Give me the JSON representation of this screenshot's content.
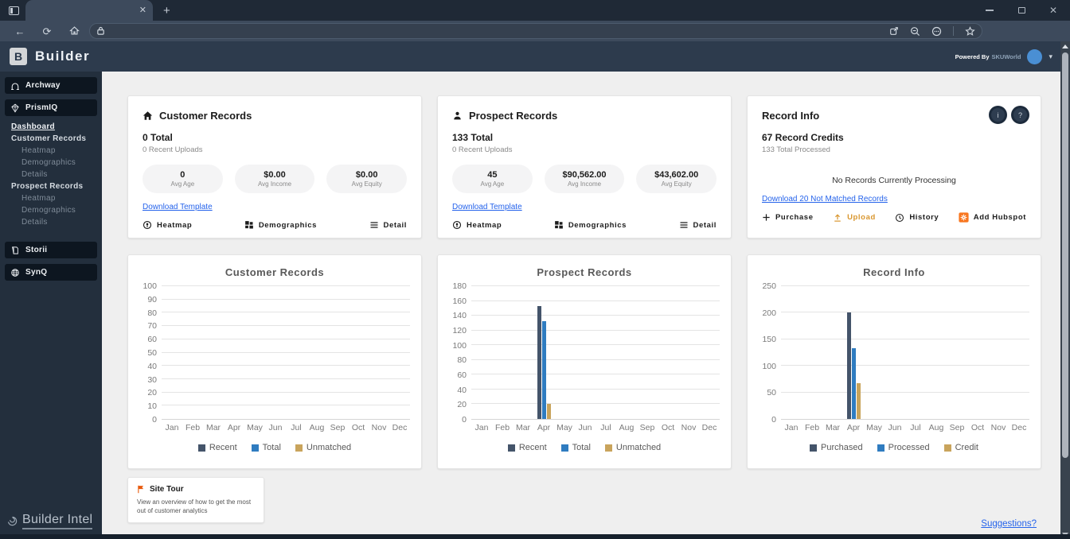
{
  "glyphs": {
    "close": "✕",
    "plus": "+",
    "back": "←",
    "refresh": "⟳",
    "caret": "▾",
    "info": "i",
    "help": "?"
  },
  "browser": {
    "tab_title": "",
    "url": ""
  },
  "header": {
    "logo_letter": "B",
    "app_name": "Builder",
    "powered_by_label": "Powered By",
    "powered_by_brand": "SKUWorld"
  },
  "sidebar": {
    "items_top": [
      {
        "label": "Archway",
        "icon": "arch-icon"
      },
      {
        "label": "PrismIQ",
        "icon": "prism-icon"
      }
    ],
    "submenu": [
      {
        "label": "Dashboard",
        "style": "active-link"
      },
      {
        "label": "Customer Records",
        "style": "group"
      },
      {
        "label": "Heatmap",
        "style": "sub"
      },
      {
        "label": "Demographics",
        "style": "sub"
      },
      {
        "label": "Details",
        "style": "sub"
      },
      {
        "label": "Prospect Records",
        "style": "group"
      },
      {
        "label": "Heatmap",
        "style": "sub"
      },
      {
        "label": "Demographics",
        "style": "sub"
      },
      {
        "label": "Details",
        "style": "sub"
      }
    ],
    "items_bottom": [
      {
        "label": "Storii",
        "icon": "book-icon"
      },
      {
        "label": "SynQ",
        "icon": "globe-icon"
      }
    ],
    "footer_logo": "Builder Intel"
  },
  "cards": {
    "customer": {
      "title": "Customer Records",
      "total": "0 Total",
      "uploads": "0 Recent Uploads",
      "stats": [
        {
          "value": "0",
          "label": "Avg Age"
        },
        {
          "value": "$0.00",
          "label": "Avg Income"
        },
        {
          "value": "$0.00",
          "label": "Avg Equity"
        }
      ],
      "link": "Download Template",
      "actions": [
        {
          "label": "Heatmap",
          "icon": "heatmap-icon"
        },
        {
          "label": "Demographics",
          "icon": "grid-icon"
        },
        {
          "label": "Detail",
          "icon": "list-icon"
        }
      ]
    },
    "prospect": {
      "title": "Prospect Records",
      "total": "133 Total",
      "uploads": "0 Recent Uploads",
      "stats": [
        {
          "value": "45",
          "label": "Avg Age"
        },
        {
          "value": "$90,562.00",
          "label": "Avg Income"
        },
        {
          "value": "$43,602.00",
          "label": "Avg Equity"
        }
      ],
      "link": "Download Template",
      "actions": [
        {
          "label": "Heatmap",
          "icon": "heatmap-icon"
        },
        {
          "label": "Demographics",
          "icon": "grid-icon"
        },
        {
          "label": "Detail",
          "icon": "list-icon"
        }
      ]
    },
    "record_info": {
      "title": "Record Info",
      "credits": "67 Record Credits",
      "processed": "133 Total Processed",
      "status": "No Records Currently Processing",
      "link": "Download 20 Not Matched Records",
      "actions": [
        {
          "label": "Purchase",
          "icon": "plus-icon"
        },
        {
          "label": "Upload",
          "icon": "upload-icon",
          "color": "#d9962e"
        },
        {
          "label": "History",
          "icon": "clock-icon"
        },
        {
          "label": "Add Hubspot",
          "icon": "hubspot-icon"
        }
      ]
    }
  },
  "chart_data": [
    {
      "type": "bar",
      "title": "Customer Records",
      "categories": [
        "Jan",
        "Feb",
        "Mar",
        "Apr",
        "May",
        "Jun",
        "Jul",
        "Aug",
        "Sep",
        "Oct",
        "Nov",
        "Dec"
      ],
      "ylim": [
        0,
        100
      ],
      "ytick_step": 10,
      "grid": true,
      "legend_position": "bottom",
      "series": [
        {
          "name": "Recent",
          "color": "#44546A",
          "values": [
            0,
            0,
            0,
            0,
            0,
            0,
            0,
            0,
            0,
            0,
            0,
            0
          ]
        },
        {
          "name": "Total",
          "color": "#2F7CC0",
          "values": [
            0,
            0,
            0,
            0,
            0,
            0,
            0,
            0,
            0,
            0,
            0,
            0
          ]
        },
        {
          "name": "Unmatched",
          "color": "#C9A45C",
          "values": [
            0,
            0,
            0,
            0,
            0,
            0,
            0,
            0,
            0,
            0,
            0,
            0
          ]
        }
      ]
    },
    {
      "type": "bar",
      "title": "Prospect Records",
      "categories": [
        "Jan",
        "Feb",
        "Mar",
        "Apr",
        "May",
        "Jun",
        "Jul",
        "Aug",
        "Sep",
        "Oct",
        "Nov",
        "Dec"
      ],
      "ylim": [
        0,
        180
      ],
      "ytick_step": 20,
      "grid": true,
      "legend_position": "bottom",
      "series": [
        {
          "name": "Recent",
          "color": "#44546A",
          "values": [
            0,
            0,
            0,
            153,
            0,
            0,
            0,
            0,
            0,
            0,
            0,
            0
          ]
        },
        {
          "name": "Total",
          "color": "#2F7CC0",
          "values": [
            0,
            0,
            0,
            133,
            0,
            0,
            0,
            0,
            0,
            0,
            0,
            0
          ]
        },
        {
          "name": "Unmatched",
          "color": "#C9A45C",
          "values": [
            0,
            0,
            0,
            20,
            0,
            0,
            0,
            0,
            0,
            0,
            0,
            0
          ]
        }
      ]
    },
    {
      "type": "bar",
      "title": "Record Info",
      "categories": [
        "Jan",
        "Feb",
        "Mar",
        "Apr",
        "May",
        "Jun",
        "Jul",
        "Aug",
        "Sep",
        "Oct",
        "Nov",
        "Dec"
      ],
      "ylim": [
        0,
        250
      ],
      "ytick_step": 50,
      "grid": true,
      "legend_position": "bottom",
      "series": [
        {
          "name": "Purchased",
          "color": "#44546A",
          "values": [
            0,
            0,
            0,
            200,
            0,
            0,
            0,
            0,
            0,
            0,
            0,
            0
          ]
        },
        {
          "name": "Processed",
          "color": "#2F7CC0",
          "values": [
            0,
            0,
            0,
            133,
            0,
            0,
            0,
            0,
            0,
            0,
            0,
            0
          ]
        },
        {
          "name": "Credit",
          "color": "#C9A45C",
          "values": [
            0,
            0,
            0,
            67,
            0,
            0,
            0,
            0,
            0,
            0,
            0,
            0
          ]
        }
      ]
    }
  ],
  "footer": {
    "site_tour_title": "Site Tour",
    "site_tour_description": "View an overview of how to get the most out of customer analytics",
    "suggestions_link": "Suggestions?"
  },
  "colors": {
    "link_blue": "#2563eb",
    "upload_orange": "#d9962e",
    "hubspot_orange": "#f8761f",
    "avatar_blue": "#4a8fd4",
    "bar_navy": "#44546A",
    "bar_blue": "#2F7CC0",
    "bar_gold": "#C9A45C"
  }
}
